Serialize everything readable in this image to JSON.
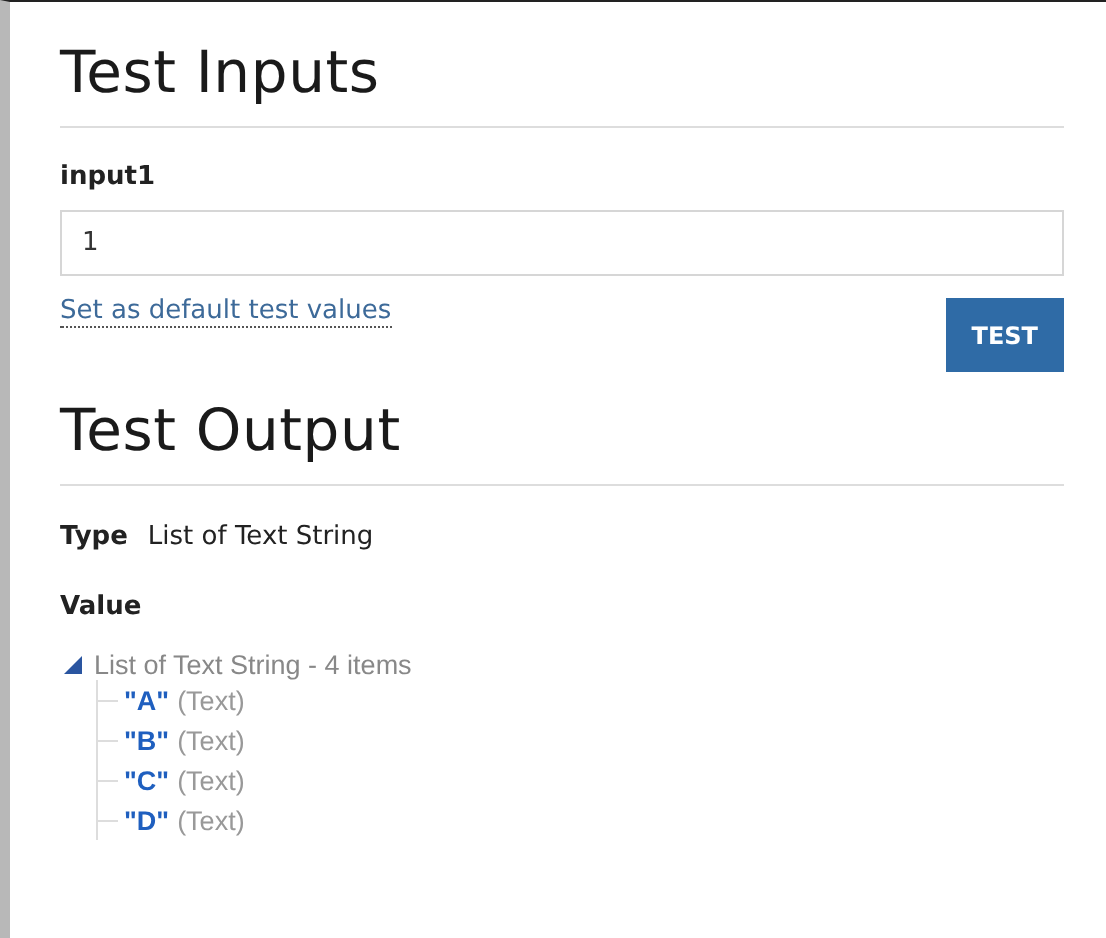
{
  "inputs": {
    "heading": "Test Inputs",
    "fields": [
      {
        "label": "input1",
        "value": "1"
      }
    ],
    "default_link": "Set as default test values",
    "test_button": "TEST"
  },
  "output": {
    "heading": "Test Output",
    "type_label": "Type",
    "type_value": "List of Text String",
    "value_label": "Value",
    "tree": {
      "label": "List of Text String - 4 items",
      "expanded": true,
      "children": [
        {
          "value": "\"A\"",
          "type": "(Text)"
        },
        {
          "value": "\"B\"",
          "type": "(Text)"
        },
        {
          "value": "\"C\"",
          "type": "(Text)"
        },
        {
          "value": "\"D\"",
          "type": "(Text)"
        }
      ]
    }
  }
}
